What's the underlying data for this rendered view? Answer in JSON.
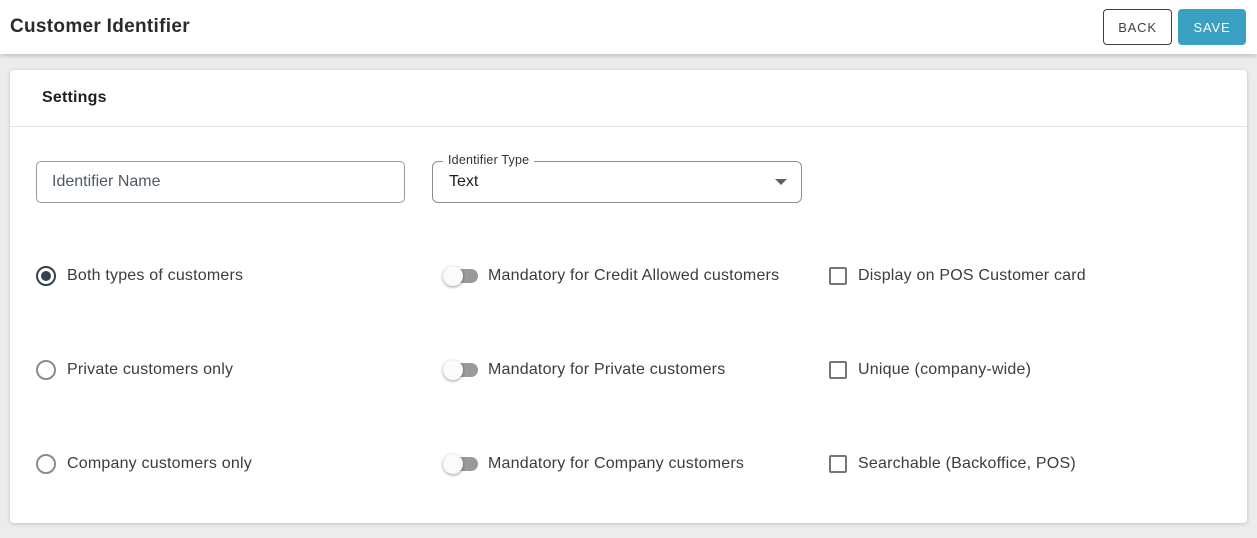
{
  "header": {
    "title": "Customer Identifier",
    "back_label": "BACK",
    "save_label": "SAVE"
  },
  "card": {
    "title": "Settings"
  },
  "form": {
    "identifier_name": {
      "placeholder": "Identifier Name",
      "value": ""
    },
    "identifier_type": {
      "label": "Identifier Type",
      "value": "Text",
      "arrow_icon": "caret-down"
    },
    "radios": [
      {
        "label": "Both types of customers",
        "selected": true
      },
      {
        "label": "Private customers only",
        "selected": false
      },
      {
        "label": "Company customers only",
        "selected": false
      }
    ],
    "toggles": [
      {
        "label": "Mandatory for Credit Allowed customers",
        "on": false
      },
      {
        "label": "Mandatory for Private customers",
        "on": false
      },
      {
        "label": "Mandatory for Company customers",
        "on": false
      }
    ],
    "checkboxes": [
      {
        "label": "Display on POS Customer card",
        "checked": false
      },
      {
        "label": "Unique (company-wide)",
        "checked": false
      },
      {
        "label": "Searchable (Backoffice, POS)",
        "checked": false
      }
    ]
  },
  "colors": {
    "accent": "#3AA0C2",
    "radio_selected": "#33424E",
    "page_background": "#ECECEC"
  }
}
